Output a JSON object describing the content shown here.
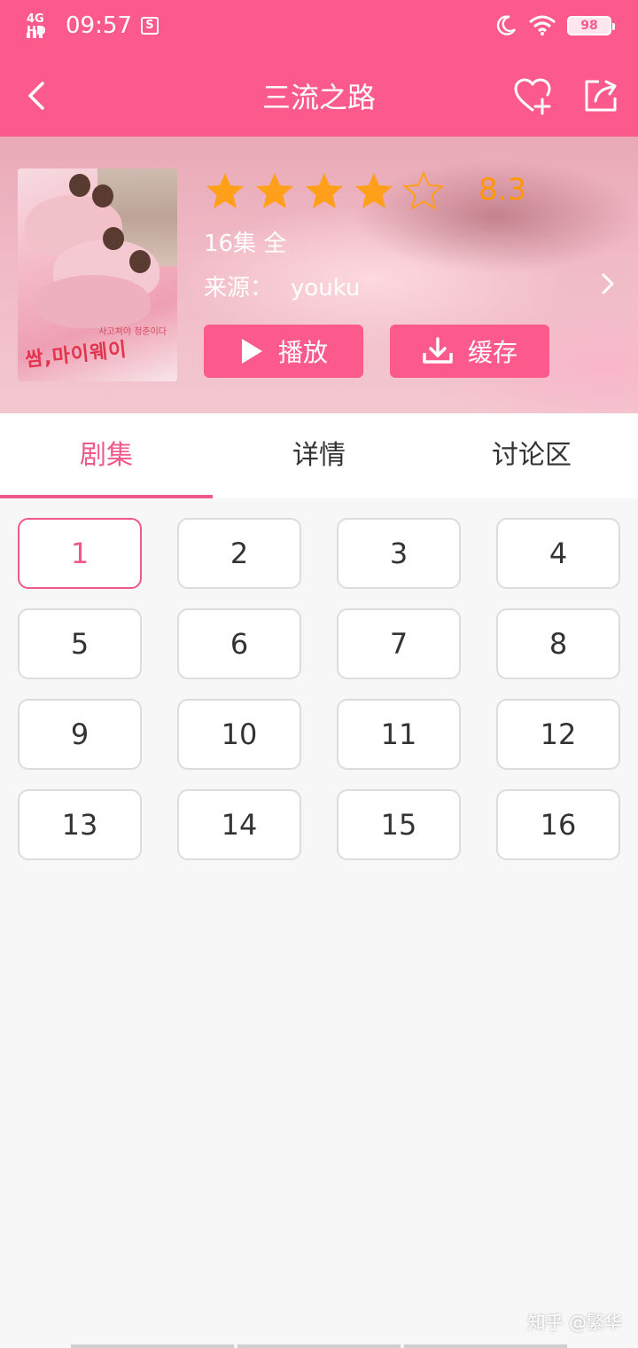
{
  "status": {
    "network": "4G HD",
    "time": "09:57",
    "sim_icon": "S",
    "battery": "98"
  },
  "header": {
    "title": "三流之路"
  },
  "show": {
    "rating_stars": 4,
    "rating_max": 5,
    "score": "8.3",
    "episodes_total": "16集 全",
    "source_label": "来源：",
    "source_value": "youku",
    "poster_title": "쌈,마이웨이",
    "poster_tagline": "사고쳐야 청춘이다"
  },
  "actions": {
    "play_label": "播放",
    "cache_label": "缓存"
  },
  "tabs": [
    {
      "label": "剧集",
      "active": true
    },
    {
      "label": "详情",
      "active": false
    },
    {
      "label": "讨论区",
      "active": false
    }
  ],
  "episodes": {
    "selected": "1",
    "items": [
      "1",
      "2",
      "3",
      "4",
      "5",
      "6",
      "7",
      "8",
      "9",
      "10",
      "11",
      "12",
      "13",
      "14",
      "15",
      "16"
    ]
  },
  "watermark": "知乎 @繁华",
  "colors": {
    "brand": "#fc5a8d",
    "accent": "#f0588a",
    "score": "#ff9800",
    "star": "#ff9f1a"
  },
  "icons": {
    "back": "chevron-left-icon",
    "favorite": "heart-plus-icon",
    "share": "share-icon",
    "play": "play-icon",
    "download": "download-icon",
    "source_arrow": "chevron-right-icon"
  }
}
